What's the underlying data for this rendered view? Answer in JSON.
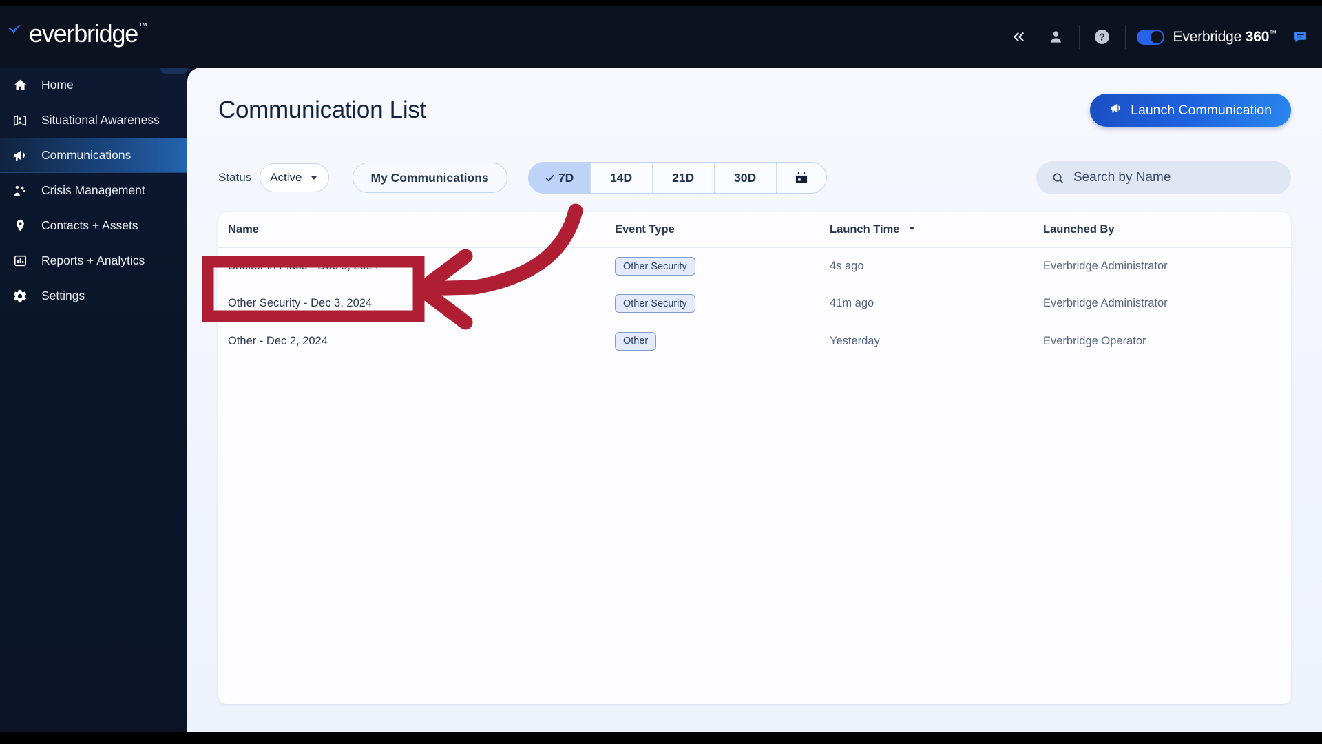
{
  "header": {
    "logo_text": "everbridge",
    "logo_tm": "™",
    "collapse_icon": "chevron-double-left-icon",
    "user_icon": "user-icon",
    "help_icon": "help-circle-icon",
    "brand_toggle_prefix": "Everbridge ",
    "brand_toggle_bold": "360",
    "brand_toggle_tm": "™",
    "chat_icon": "chat-bubble-icon",
    "toggle_state": "on",
    "accent_color": "#2563eb"
  },
  "sidebar": {
    "collapse_label": "«",
    "items": [
      {
        "label": "Home",
        "icon": "home-icon",
        "active": false
      },
      {
        "label": "Situational Awareness",
        "icon": "map-person-icon",
        "active": false
      },
      {
        "label": "Communications",
        "icon": "megaphone-icon",
        "active": true
      },
      {
        "label": "Crisis Management",
        "icon": "people-network-icon",
        "active": false
      },
      {
        "label": "Contacts + Assets",
        "icon": "location-pin-icon",
        "active": false
      },
      {
        "label": "Reports + Analytics",
        "icon": "bar-chart-icon",
        "active": false
      },
      {
        "label": "Settings",
        "icon": "gear-icon",
        "active": false
      }
    ]
  },
  "page": {
    "title": "Communication List",
    "launch_button": "Launch Communication",
    "launch_icon": "megaphone-icon"
  },
  "filters": {
    "status_label": "Status",
    "status_value": "Active",
    "status_caret": "chevron-down-icon",
    "my_communications": "My Communications",
    "ranges": [
      {
        "label": "7D",
        "selected": true
      },
      {
        "label": "14D",
        "selected": false
      },
      {
        "label": "21D",
        "selected": false
      },
      {
        "label": "30D",
        "selected": false
      }
    ],
    "calendar_icon": "calendar-icon",
    "check_icon": "check-icon"
  },
  "search": {
    "placeholder": "Search by Name",
    "value": "",
    "icon": "search-icon"
  },
  "table": {
    "columns": [
      "Name",
      "Event Type",
      "Launch Time",
      "Launched By"
    ],
    "sorted_column": "Launch Time",
    "sort_icon": "caret-down-icon",
    "rows": [
      {
        "name": "Shelter in Place - Dec 3, 2024",
        "event_type": "Other Security",
        "launch_time": "4s ago",
        "launched_by": "Everbridge Administrator"
      },
      {
        "name": "Other Security - Dec 3, 2024",
        "event_type": "Other Security",
        "launch_time": "41m ago",
        "launched_by": "Everbridge Administrator"
      },
      {
        "name": "Other - Dec 2, 2024",
        "event_type": "Other",
        "launch_time": "Yesterday",
        "launched_by": "Everbridge Operator"
      }
    ]
  },
  "annotation": {
    "highlight_target": "Shelter in Place - Dec 3, 2024",
    "color": "#b01e33",
    "shapes": [
      "highlight-rectangle",
      "curved-arrow-pointing-left"
    ]
  }
}
